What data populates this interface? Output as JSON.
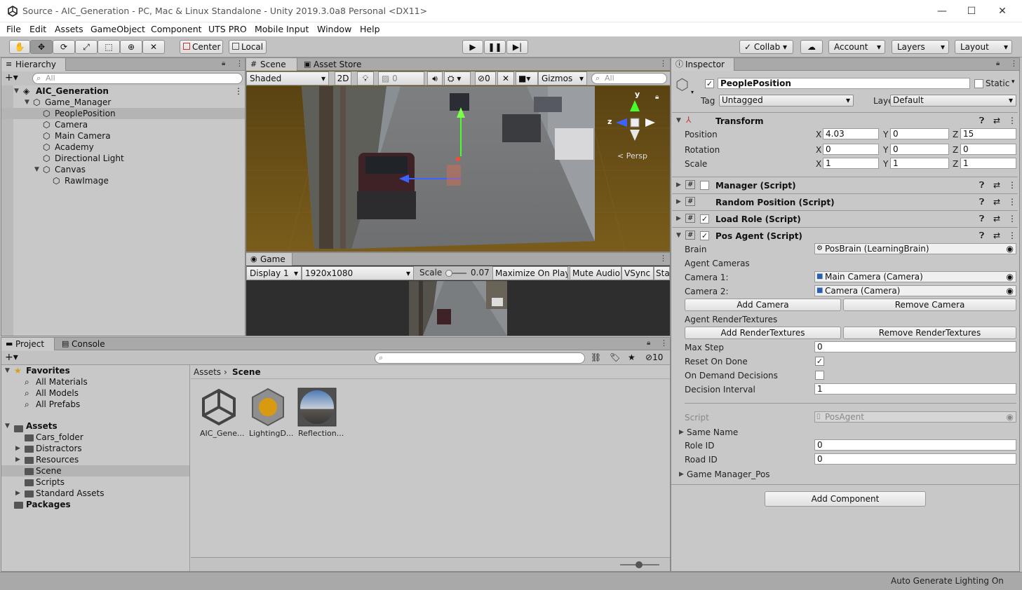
{
  "window": {
    "title": "Source - AIC_Generation - PC, Mac & Linux Standalone - Unity 2019.3.0a8 Personal <DX11>",
    "min": "—",
    "max": "☐",
    "close": "✕"
  },
  "menu": [
    "File",
    "Edit",
    "Assets",
    "GameObject",
    "Component",
    "UTS PRO",
    "Mobile Input",
    "Window",
    "Help"
  ],
  "toolbar": {
    "center": "Center",
    "local": "Local",
    "collab": "Collab",
    "account": "Account",
    "layers": "Layers",
    "layout": "Layout"
  },
  "hierarchy": {
    "tab": "Hierarchy",
    "search_placeholder": "All",
    "items": [
      {
        "label": "AIC_Generation"
      },
      {
        "label": "Game_Manager"
      },
      {
        "label": "PeoplePosition"
      },
      {
        "label": "Camera"
      },
      {
        "label": "Main Camera"
      },
      {
        "label": "Academy"
      },
      {
        "label": "Directional Light"
      },
      {
        "label": "Canvas"
      },
      {
        "label": "RawImage"
      }
    ]
  },
  "scene": {
    "tabs": [
      "Scene",
      "Asset Store"
    ],
    "shading": "Shaded",
    "mode2d": "2D",
    "light_count": "0",
    "hidden_count": "0",
    "gizmos": "Gizmos",
    "search_placeholder": "All",
    "persp": "< Persp",
    "axis_y": "y",
    "axis_z": "z"
  },
  "game": {
    "tab": "Game",
    "display": "Display 1",
    "resolution": "1920x1080",
    "scale_label": "Scale",
    "scale_value": "0.07",
    "maximize": "Maximize On Play",
    "mute": "Mute Audio",
    "vsync": "VSync",
    "stats": "Stat"
  },
  "project": {
    "tabs": [
      "Project",
      "Console"
    ],
    "hidden_count": "10",
    "favorites_label": "Favorites",
    "favorites": [
      "All Materials",
      "All Models",
      "All Prefabs"
    ],
    "assets_label": "Assets",
    "folders": [
      "Cars_folder",
      "Distractors",
      "Resources",
      "Scene",
      "Scripts",
      "Standard Assets"
    ],
    "packages_label": "Packages",
    "breadcrumb": [
      "Assets",
      "Scene"
    ],
    "breadcrumb_sep": "›",
    "files": [
      "AIC_Gene...",
      "LightingD...",
      "Reflection..."
    ]
  },
  "inspector": {
    "tab": "Inspector",
    "object_name": "PeoplePosition",
    "static": "Static",
    "tag_label": "Tag",
    "tag": "Untagged",
    "layer_label": "Layer",
    "layer": "Default",
    "transform": {
      "title": "Transform",
      "position_label": "Position",
      "position": [
        "4.03",
        "0",
        "15"
      ],
      "rotation_label": "Rotation",
      "rotation": [
        "0",
        "0",
        "0"
      ],
      "scale_label": "Scale",
      "scale": [
        "1",
        "1",
        "1"
      ],
      "axes": [
        "X",
        "Y",
        "Z"
      ]
    },
    "components": [
      "Manager (Script)",
      "Random Position (Script)",
      "Load Role (Script)",
      "Pos Agent (Script)"
    ],
    "pos_agent": {
      "brain_label": "Brain",
      "brain": "PosBrain (LearningBrain)",
      "agent_cameras": "Agent Cameras",
      "camera1_label": "Camera 1:",
      "camera1": "Main Camera (Camera)",
      "camera2_label": "Camera 2:",
      "camera2": "Camera (Camera)",
      "add_camera": "Add Camera",
      "remove_camera": "Remove Camera",
      "agent_rt": "Agent RenderTextures",
      "add_rt": "Add RenderTextures",
      "remove_rt": "Remove RenderTextures",
      "max_step_label": "Max Step",
      "max_step": "0",
      "reset_label": "Reset On Done",
      "on_demand_label": "On Demand Decisions",
      "decision_label": "Decision Interval",
      "decision": "1",
      "script_label": "Script",
      "script": "PosAgent",
      "same_name": "Same Name",
      "role_id_label": "Role ID",
      "role_id": "0",
      "road_id_label": "Road ID",
      "road_id": "0",
      "gm_pos": "Game Manager_Pos"
    },
    "add_component": "Add Component"
  },
  "status": "Auto Generate Lighting On",
  "colors": {
    "selection": "#b4b4b4",
    "scene_bg": "#6d5516",
    "panel": "#c8c8c8"
  }
}
